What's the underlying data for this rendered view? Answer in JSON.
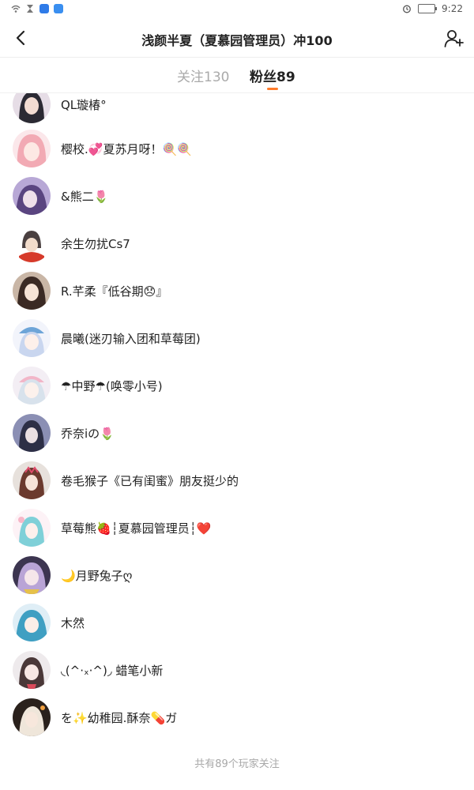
{
  "status_bar": {
    "time": "9:22"
  },
  "header": {
    "title": "浅颜半夏（夏慕园管理员）冲100"
  },
  "tabs": [
    {
      "label": "关注130",
      "active": false
    },
    {
      "label": "粉丝89",
      "active": true
    }
  ],
  "accent_color": "#ff7b2a",
  "fans": [
    {
      "name": "QL璇椿°"
    },
    {
      "name": "樱校.💞夏苏月呀！🍭🍭"
    },
    {
      "name": "&熊二🌷"
    },
    {
      "name": "余生勿扰Cs7"
    },
    {
      "name": "R.芊柔『低谷期😞』"
    },
    {
      "name": "晨曦(迷刃输入团和草莓团)"
    },
    {
      "name": "☂中野☂(唤零小号)"
    },
    {
      "name": "乔奈iの🌷"
    },
    {
      "name": "卷毛猴子《已有闺蜜》朋友挺少的"
    },
    {
      "name": "草莓熊🍓┆夏慕园管理员┆❤️"
    },
    {
      "name": "🌙月野兔子ღ"
    },
    {
      "name": "木然"
    },
    {
      "name": "◟(^·ₓ·^)◞ 蜡笔小新"
    },
    {
      "name": "を✨幼稚园.酥奈💊ガ"
    }
  ],
  "footer": {
    "text": "共有89个玩家关注"
  }
}
